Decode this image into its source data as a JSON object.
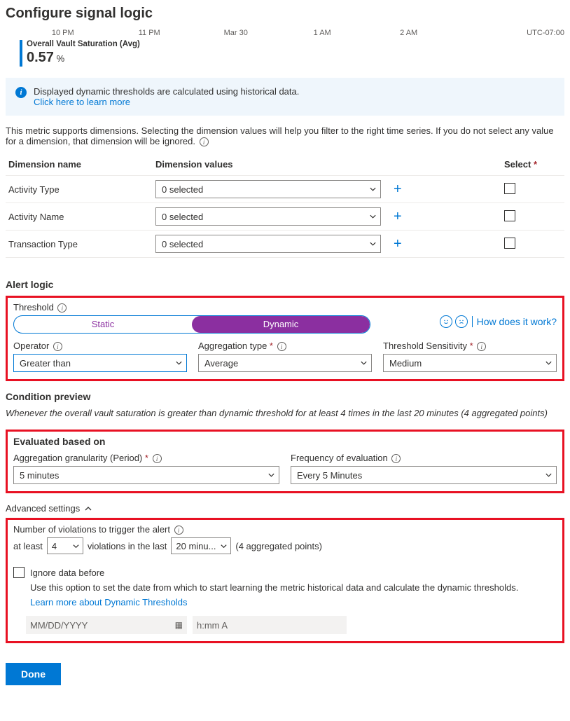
{
  "title": "Configure signal logic",
  "time_axis": [
    "10 PM",
    "11 PM",
    "Mar 30",
    "1 AM",
    "2 AM",
    "UTC-07:00"
  ],
  "metric": {
    "name": "Overall Vault Saturation (Avg)",
    "value": "0.57",
    "unit": "%"
  },
  "info_banner": {
    "text": "Displayed dynamic thresholds are calculated using historical data.",
    "link": "Click here to learn more"
  },
  "dimensions_intro": "This metric supports dimensions. Selecting the dimension values will help you filter to the right time series. If you do not select any value for a dimension, that dimension will be ignored.",
  "dim_headers": {
    "name": "Dimension name",
    "values": "Dimension values",
    "select": "Select"
  },
  "dim_rows": [
    {
      "name": "Activity Type",
      "value": "0 selected"
    },
    {
      "name": "Activity Name",
      "value": "0 selected"
    },
    {
      "name": "Transaction Type",
      "value": "0 selected"
    }
  ],
  "alert_logic_h": "Alert logic",
  "threshold_label": "Threshold",
  "toggle": {
    "static": "Static",
    "dynamic": "Dynamic"
  },
  "how_link": "How does it work?",
  "operator": {
    "label": "Operator",
    "value": "Greater than"
  },
  "aggregation": {
    "label": "Aggregation type",
    "value": "Average"
  },
  "sensitivity": {
    "label": "Threshold Sensitivity",
    "value": "Medium"
  },
  "preview_h": "Condition preview",
  "preview_text": "Whenever the overall vault saturation is greater than dynamic threshold for at least 4 times in the last 20 minutes (4 aggregated points)",
  "eval_h": "Evaluated based on",
  "granularity": {
    "label": "Aggregation granularity (Period)",
    "value": "5 minutes"
  },
  "frequency": {
    "label": "Frequency of evaluation",
    "value": "Every 5 Minutes"
  },
  "advanced_label": "Advanced settings",
  "violations": {
    "label": "Number of violations to trigger the alert",
    "prefix": "at least",
    "count": "4",
    "middle": "violations in the last",
    "window": "20 minu...",
    "suffix": "(4 aggregated points)"
  },
  "ignore": {
    "label": "Ignore data before",
    "desc": "Use this option to set the date from which to start learning the metric historical data and calculate the dynamic thresholds.",
    "learn": "Learn more about Dynamic Thresholds",
    "date_ph": "MM/DD/YYYY",
    "time_ph": "h:mm A"
  },
  "done": "Done"
}
